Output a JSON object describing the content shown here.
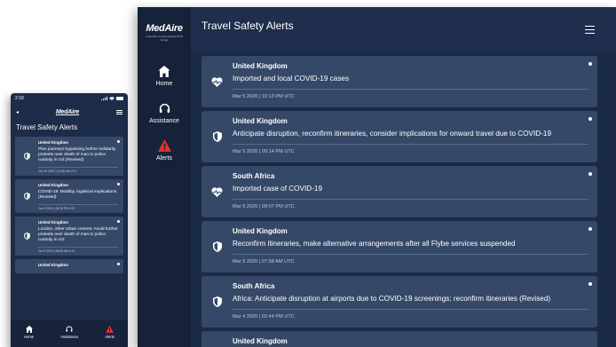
{
  "phone": {
    "status": {
      "time": "2:18"
    },
    "top": {
      "back": "◂",
      "logo": "MedAire"
    },
    "title": "Travel Safety Alerts",
    "alerts": [
      {
        "icon": "shield-icon",
        "country": "United Kingdom",
        "headline": "Plan journeys bypassing further solidarity protests over death of man in police custody in US (Revised)",
        "date": "Jun 10 2020 | 12:56 AM UTC"
      },
      {
        "icon": "shield-icon",
        "country": "United Kingdom",
        "headline": "COVID-19: Mobility, logistical implications (Revised)",
        "date": "Jun 9 2020 | 08:15 PM UTC"
      },
      {
        "icon": "shield-icon",
        "country": "United Kingdom",
        "headline": "London, other urban centres: Avoid further protests over death of man in police custody in US",
        "date": "Jun 9 2020 | 08:59 AM UTC"
      },
      {
        "icon": "shield-icon",
        "country": "United Kingdom",
        "headline": "",
        "date": ""
      }
    ],
    "nav": [
      {
        "label": "Home",
        "icon": "home-icon"
      },
      {
        "label": "Assistance",
        "icon": "headset-icon"
      },
      {
        "label": "Alerts",
        "icon": "alert-triangle-icon"
      }
    ]
  },
  "tablet": {
    "logo": {
      "name": "MedAire",
      "sub": "A Member of International SOS Group"
    },
    "nav": [
      {
        "label": "Home",
        "icon": "home-icon"
      },
      {
        "label": "Assistance",
        "icon": "headset-icon"
      },
      {
        "label": "Alerts",
        "icon": "alert-triangle-icon"
      }
    ],
    "header": {
      "title": "Travel Safety Alerts"
    },
    "alerts": [
      {
        "icon": "heartbeat-icon",
        "country": "United Kingdom",
        "headline": "Imported and local COVID-19 cases",
        "date": "Mar 5 2020 | 10:13 PM UTC"
      },
      {
        "icon": "shield-icon",
        "country": "United Kingdom",
        "headline": "Anticipate disruption, reconfirm itineraries, consider implications for onward travel due to COVID-19",
        "date": "Mar 5 2020 | 09:14 PM UTC"
      },
      {
        "icon": "heartbeat-icon",
        "country": "South Africa",
        "headline": "Imported case of COVID-19",
        "date": "Mar 5 2020 | 09:07 PM UTC"
      },
      {
        "icon": "shield-icon",
        "country": "United Kingdom",
        "headline": "Reconfirm itineraries, make alternative arrangements after all Flybe services suspended",
        "date": "Mar 5 2020 | 07:58 AM UTC"
      },
      {
        "icon": "shield-icon",
        "country": "South Africa",
        "headline": "Africa: Anticipate disruption at airports due to COVID-19 screenings; reconfirm itineraries (Revised)",
        "date": "Mar 4 2020 | 02:44 PM UTC"
      },
      {
        "icon": "shield-icon",
        "country": "United Kingdom",
        "headline": "",
        "date": ""
      }
    ]
  },
  "colors": {
    "sidebar": "#152239",
    "header": "#1f2e4c",
    "card": "#354868",
    "alert_red": "#e8322f"
  }
}
